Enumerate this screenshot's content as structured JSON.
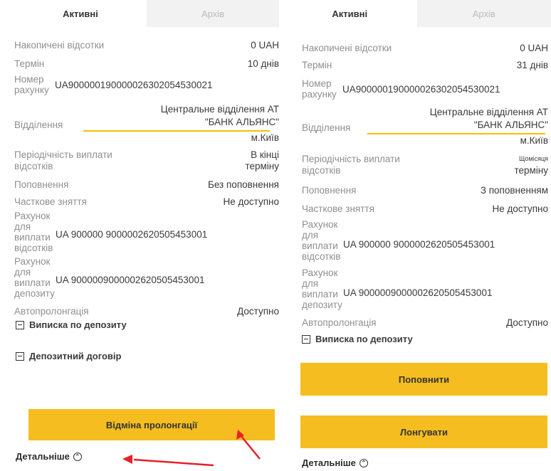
{
  "left": {
    "tabs": {
      "active": "Активні",
      "inactive": "Архів"
    },
    "rows": {
      "accrued_label": "Накопичені відсотки",
      "accrued_value": "0 UAH",
      "term_label": "Термін",
      "term_value": "10 днів",
      "account_label_1": "Номер",
      "account_label_2": "рахунку",
      "account_value": "UA900000190000026302054530021",
      "branch_label": "Відділення",
      "branch_value_1": "Центральне відділення АТ",
      "branch_value_2": "\"БАНК АЛЬЯНС\"",
      "branch_value_3": "м.Київ",
      "period_label_1": "Періодічність виплати",
      "period_label_2": "відсотків",
      "period_value_1": "В кінці",
      "period_value_2": "терміну",
      "topup_label": "Поповнення",
      "topup_value": "Без поповнення",
      "partial_label": "Часткове зняття",
      "partial_value": "Не доступно",
      "pay_interest_label": [
        "Рахунок",
        "для",
        "виплати",
        "відсотків"
      ],
      "pay_interest_value": "UA  900000 9000002620505453001",
      "pay_deposit_label": [
        "Рахунок",
        "для",
        "виплати",
        "депозиту"
      ],
      "pay_deposit_value": "UA  9000009000002620505453001",
      "autoprolong_label": "Автопролонгація",
      "autoprolong_value": "Доступно"
    },
    "links": {
      "statement": "Виписка по депозиту",
      "contract": "Депозитний договір"
    },
    "button": "Відміна пролонгації",
    "more": "Детальніше",
    "more_icon": "⌃"
  },
  "right": {
    "tabs": {
      "active": "Активні",
      "inactive": "Архів"
    },
    "rows": {
      "accrued_label": "Накопичені відсотки",
      "accrued_value": "0 UAH",
      "term_label": "Термін",
      "term_value": "31 днів",
      "account_label_1": "Номер",
      "account_label_2": "рахунку",
      "account_value": "UA900000190000026302054530021",
      "branch_label": "Відділення",
      "branch_value_1": "Центральне відділення АТ",
      "branch_value_2": "\"БАНК АЛЬЯНС\"",
      "branch_value_3": "м.Київ",
      "period_label_1": "Періодічність виплати",
      "period_label_2": "відсотків",
      "period_value_1": "Щомісяця",
      "period_value_2": "терміну",
      "topup_label": "Поповнення",
      "topup_value": "З поповненням",
      "partial_label": "Часткове зняття",
      "partial_value": "Не доступно",
      "pay_interest_label": [
        "Рахунок",
        "для",
        "виплати",
        "відсотків"
      ],
      "pay_interest_value": "UA  900000 9000002620505453001",
      "pay_deposit_label": [
        "Рахунок",
        "для",
        "виплати",
        "депозиту"
      ],
      "pay_deposit_value": "UA  9000009000002620505453001",
      "autoprolong_label": "Автопролонгація",
      "autoprolong_value": "Доступно"
    },
    "links": {
      "statement": "Виписка по депозиту"
    },
    "button_topup": "Поповнити",
    "button_prolong": "Лонгувати",
    "more": "Детальніше",
    "more_icon": "⌃"
  },
  "colors": {
    "accent": "#f5bd1f",
    "underline": "#f2c200",
    "arrow": "#e8202a"
  },
  "icons": {
    "checkbox": "minus-square-icon",
    "chevron": "chevron-up-circle-icon"
  }
}
